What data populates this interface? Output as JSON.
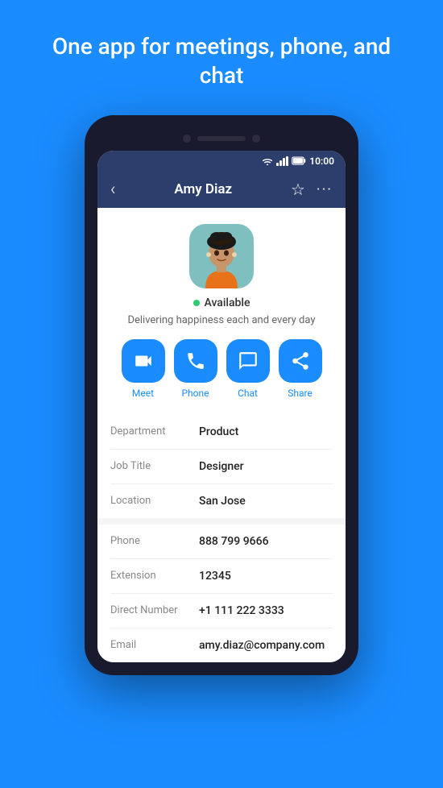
{
  "headline": "One app for meetings, phone, and chat",
  "statusBar": {
    "time": "10:00"
  },
  "nav": {
    "title": "Amy Diaz",
    "backLabel": "‹",
    "starLabel": "☆",
    "dotsLabel": "···"
  },
  "profile": {
    "statusDot": "Available",
    "statusMessage": "Delivering happiness each and every day"
  },
  "actions": [
    {
      "id": "meet",
      "label": "Meet",
      "icon": "video"
    },
    {
      "id": "phone",
      "label": "Phone",
      "icon": "phone"
    },
    {
      "id": "chat",
      "label": "Chat",
      "icon": "chat"
    },
    {
      "id": "share",
      "label": "Share",
      "icon": "share"
    }
  ],
  "contactInfo": {
    "group1": [
      {
        "label": "Department",
        "value": "Product"
      },
      {
        "label": "Job Title",
        "value": "Designer"
      },
      {
        "label": "Location",
        "value": "San Jose"
      }
    ],
    "group2": [
      {
        "label": "Phone",
        "value": "888 799 9666"
      },
      {
        "label": "Extension",
        "value": "12345"
      },
      {
        "label": "Direct Number",
        "value": "+1 111 222 3333"
      },
      {
        "label": "Email",
        "value": "amy.diaz@company.com"
      }
    ]
  }
}
